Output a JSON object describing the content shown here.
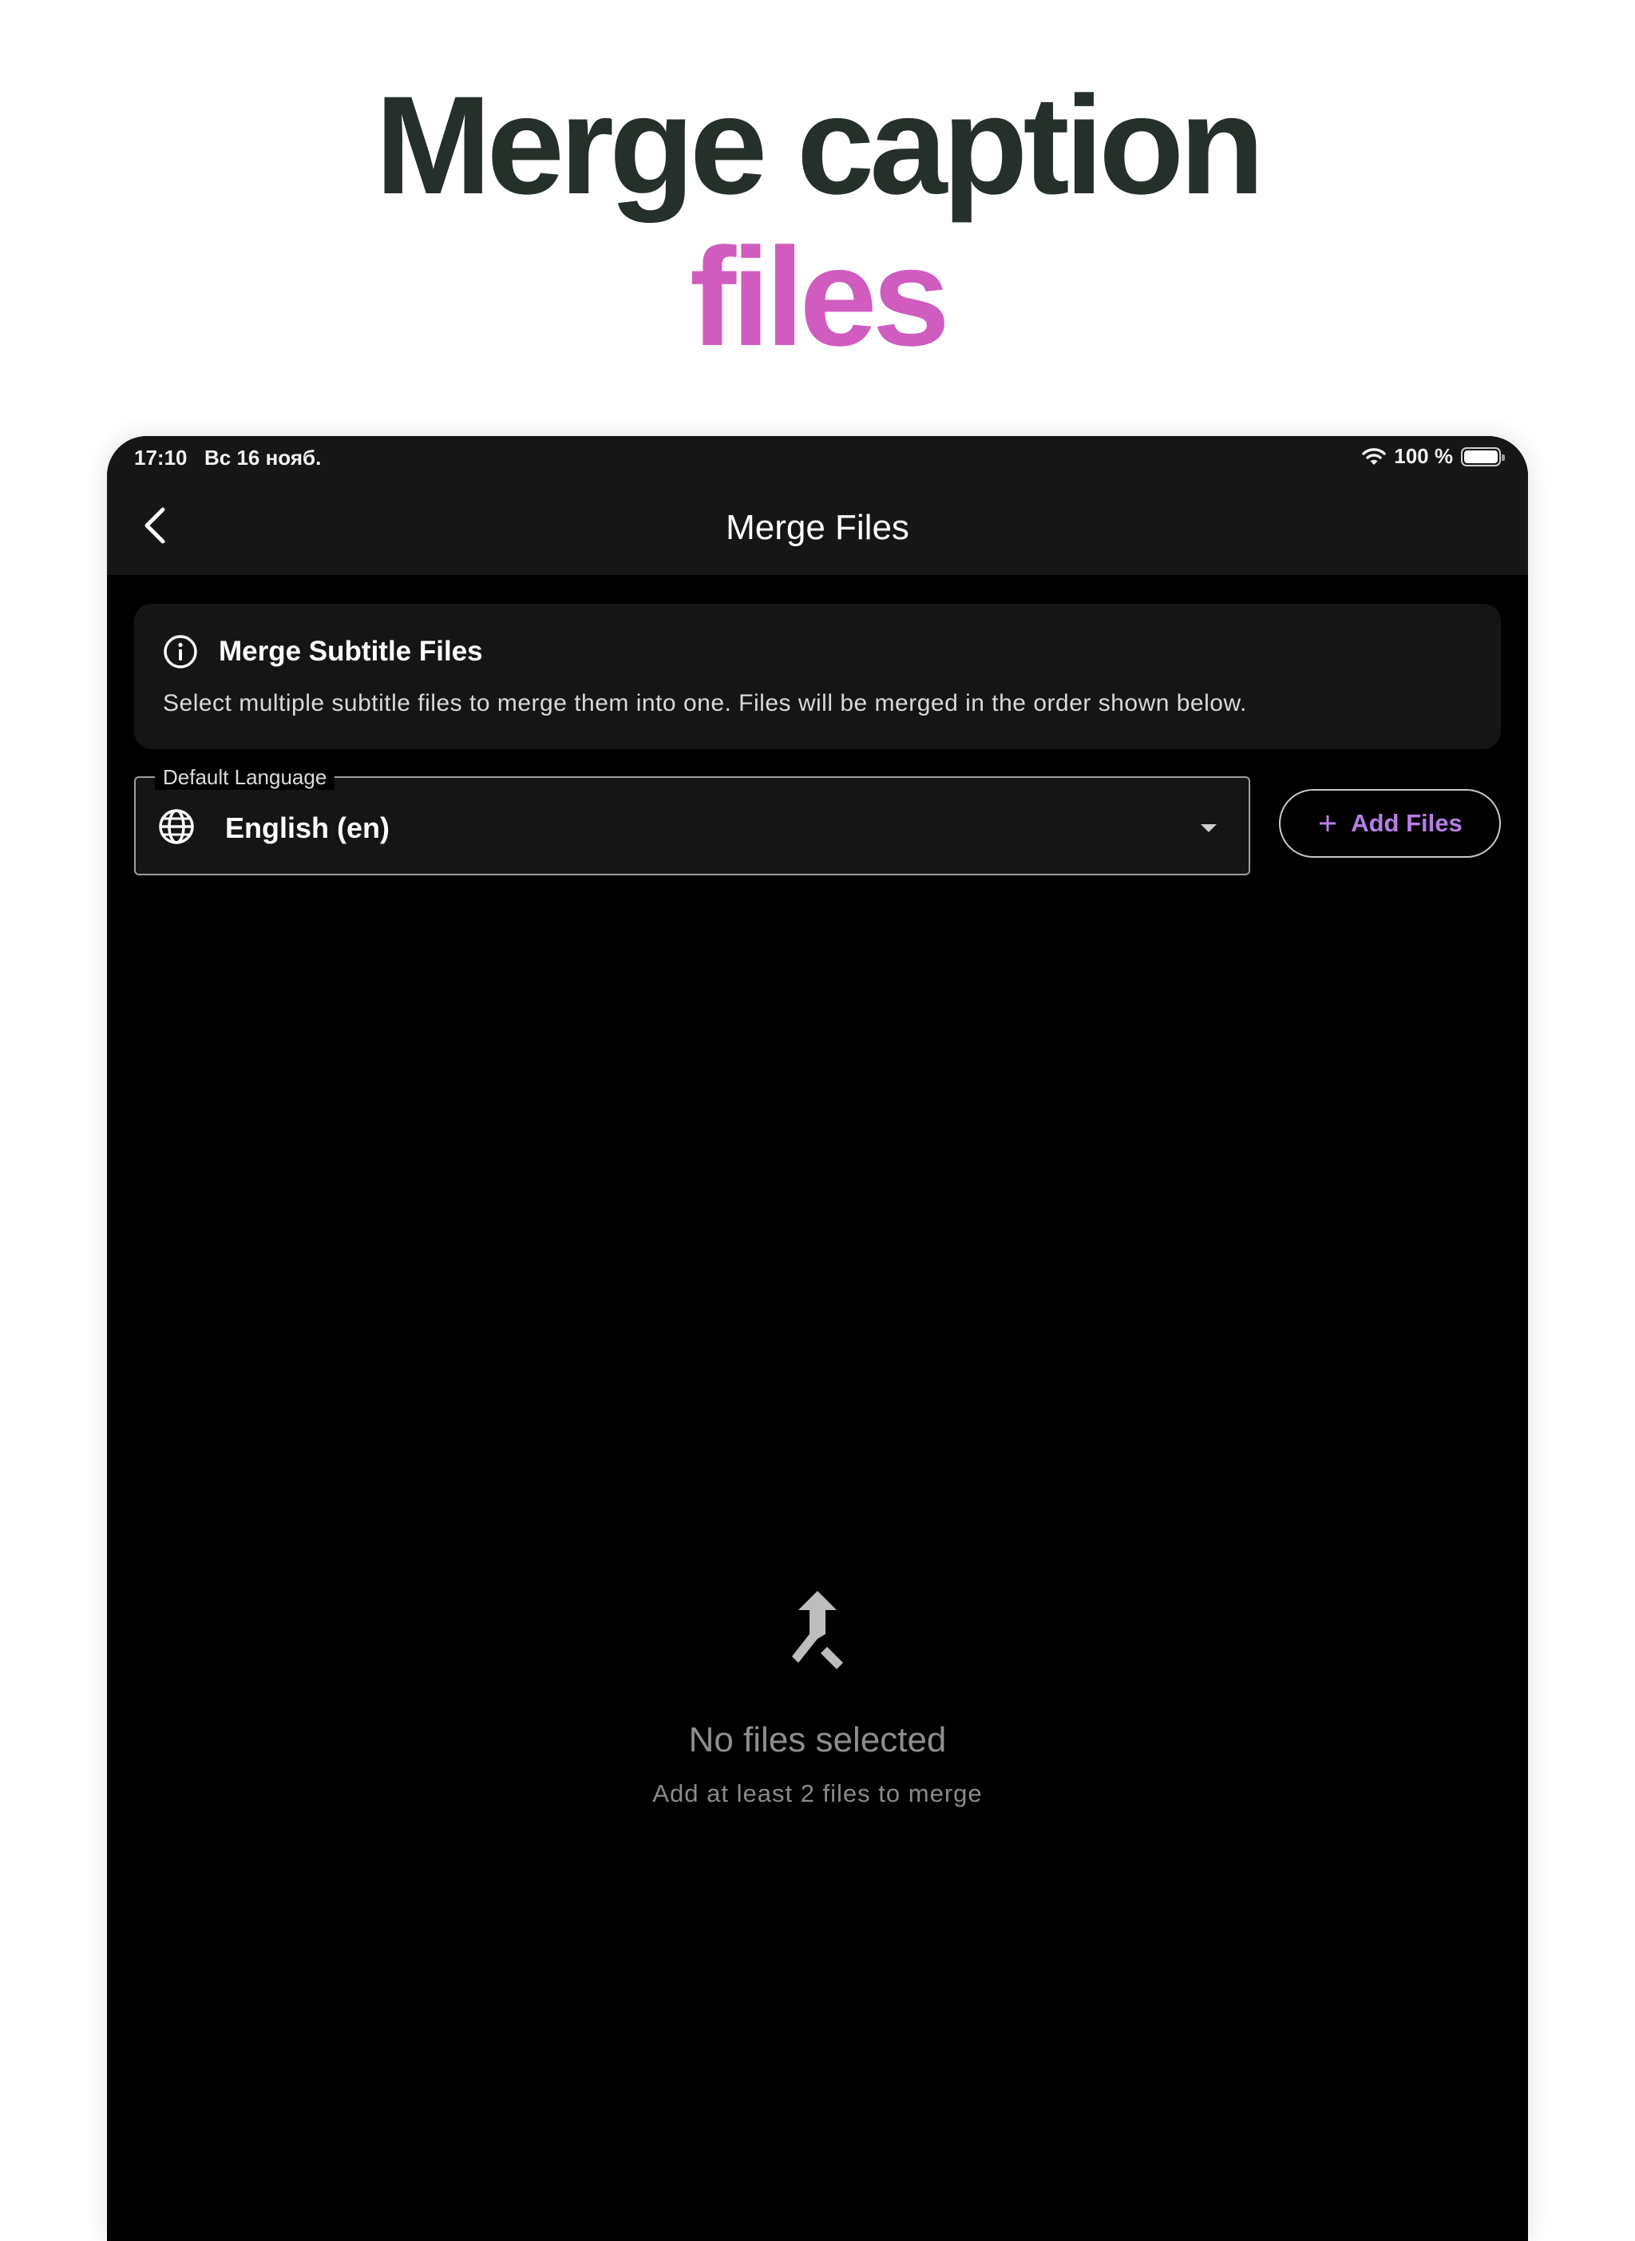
{
  "hero": {
    "line1": "Merge caption",
    "line2": "files",
    "line1_color": "#26302a",
    "line2_color": "#d05cc0"
  },
  "statusbar": {
    "time": "17:10",
    "date": "Вс 16 нояб.",
    "battery_text": "100 %",
    "battery_level": 1.0,
    "icons": [
      "wifi-icon",
      "battery-icon"
    ]
  },
  "navbar": {
    "title": "Merge Files",
    "back_icon": "chevron-left-icon"
  },
  "info_card": {
    "icon": "info-icon",
    "title": "Merge Subtitle Files",
    "text": "Select multiple subtitle files to merge them into one. Files will be merged in the order shown below."
  },
  "language_select": {
    "label": "Default Language",
    "value": "English (en)",
    "icon": "globe-icon",
    "dropdown_icon": "caret-down-icon"
  },
  "add_files": {
    "label": "Add Files",
    "icon": "plus-icon",
    "accent": "#b77de6"
  },
  "empty_state": {
    "icon": "merge-icon",
    "title": "No files selected",
    "subtitle": "Add at least 2 files to merge"
  }
}
